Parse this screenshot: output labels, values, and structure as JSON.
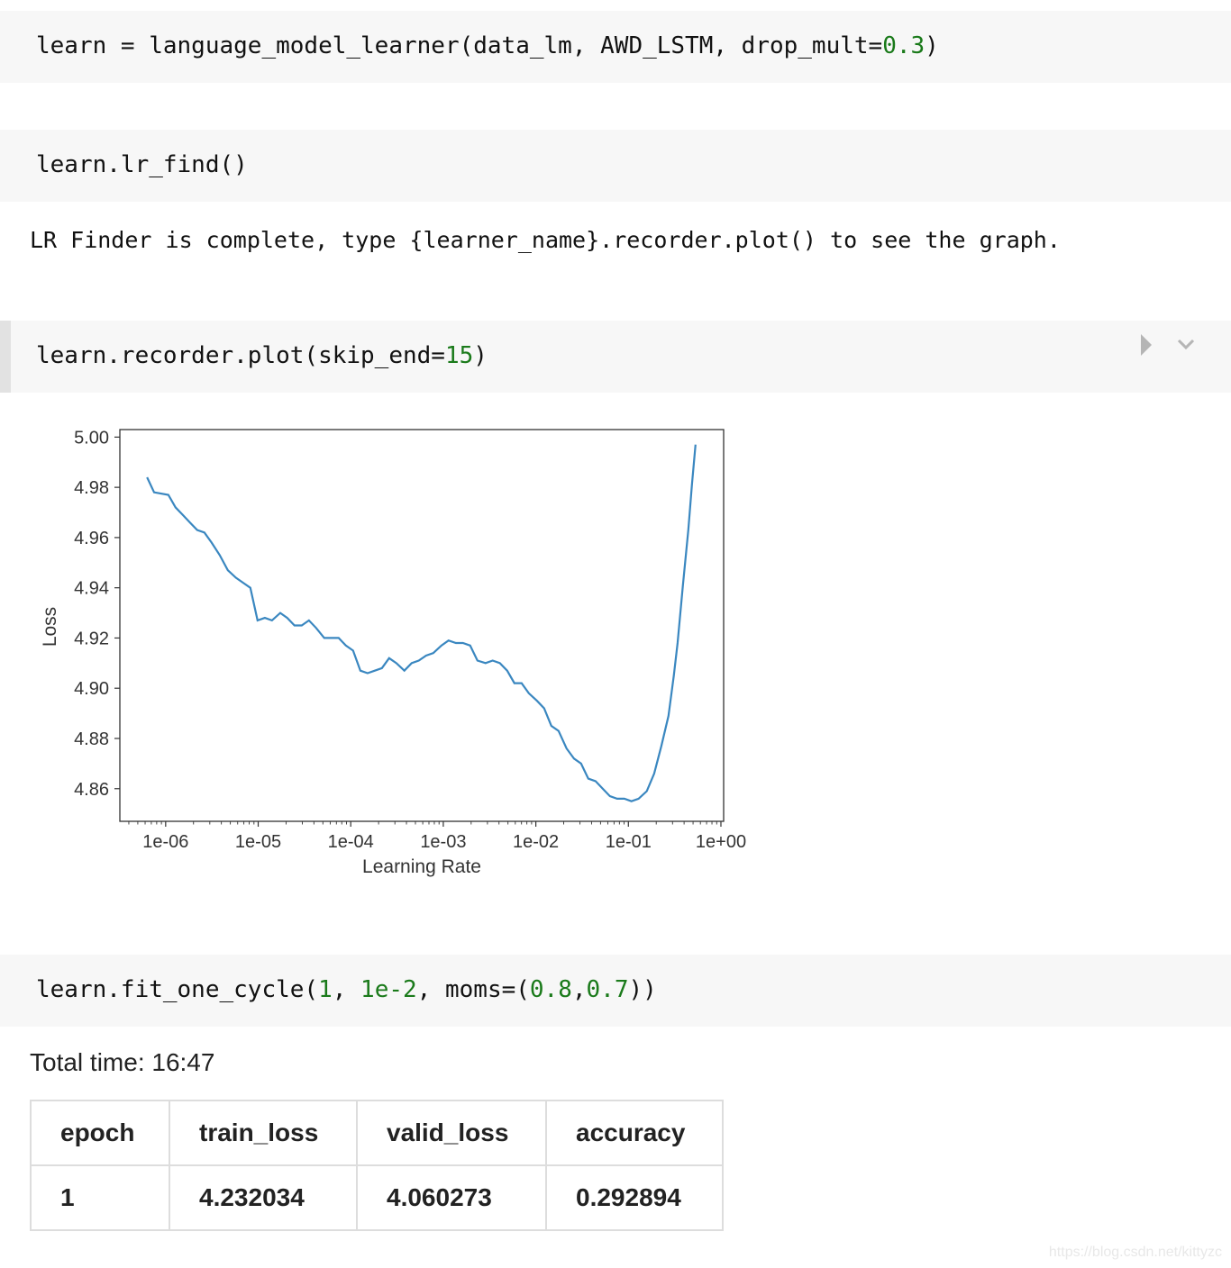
{
  "cells": [
    {
      "code_parts": [
        "learn = language_model_learner(data_lm, AWD_LSTM, drop_mult=",
        "0.3",
        ")"
      ]
    },
    {
      "code_parts": [
        "learn.lr_find()"
      ]
    },
    {
      "code_parts": [
        "learn.recorder.plot(skip_end=",
        "15",
        ")"
      ]
    },
    {
      "code_parts": [
        "learn.fit_one_cycle(",
        "1",
        ", ",
        "1e-2",
        ", moms=(",
        "0.8",
        ",",
        "0.7",
        "))"
      ]
    }
  ],
  "lr_find_output": "LR Finder is complete, type {learner_name}.recorder.plot() to see the graph.",
  "cell_toolbar": {
    "run_icon": "play-triangle-icon",
    "collapse_icon": "chevron-down-icon"
  },
  "total_time": "Total time: 16:47",
  "results_table": {
    "headers": [
      "epoch",
      "train_loss",
      "valid_loss",
      "accuracy"
    ],
    "rows": [
      [
        "1",
        "4.232034",
        "4.060273",
        "0.292894"
      ]
    ]
  },
  "watermark": "https://blog.csdn.net/kittyzc",
  "colors": {
    "line": "#3a87c0",
    "number": "#1a7a1a",
    "cell_bg": "#f7f7f7"
  },
  "chart_data": {
    "type": "line",
    "xlabel": "Learning Rate",
    "ylabel": "Loss",
    "xscale": "log",
    "xlim": [
      3.2e-07,
      1.07
    ],
    "ylim": [
      4.847,
      5.003
    ],
    "xticks": [
      "1e-06",
      "1e-05",
      "1e-04",
      "1e-03",
      "1e-02",
      "1e-01",
      "1e+00"
    ],
    "yticks": [
      "4.86",
      "4.88",
      "4.90",
      "4.92",
      "4.94",
      "4.96",
      "4.98",
      "5.00"
    ],
    "grid": false,
    "x": [
      6.3e-07,
      7.5e-07,
      1.07e-06,
      1.28e-06,
      1.53e-06,
      1.83e-06,
      2.19e-06,
      2.62e-06,
      3.14e-06,
      3.84e-06,
      4.7e-06,
      5.75e-06,
      6.87e-06,
      8.22e-06,
      9.84e-06,
      1.18e-05,
      1.41e-05,
      1.73e-05,
      2.06e-05,
      2.47e-05,
      2.95e-05,
      3.53e-05,
      4.23e-05,
      5.17e-05,
      6.19e-05,
      7.4e-05,
      8.86e-05,
      0.000106,
      0.000127,
      0.000152,
      0.000182,
      0.000217,
      0.00026,
      0.000311,
      0.00038,
      0.000455,
      0.000544,
      0.000652,
      0.00078,
      0.000955,
      0.00114,
      0.00137,
      0.00163,
      0.00195,
      0.00234,
      0.00286,
      0.00342,
      0.00409,
      0.0049,
      0.00586,
      0.00701,
      0.00839,
      0.0103,
      0.0123,
      0.0147,
      0.0176,
      0.0215,
      0.0258,
      0.0308,
      0.0369,
      0.0442,
      0.0528,
      0.0631,
      0.0755,
      0.0904,
      0.108,
      0.129,
      0.158,
      0.19,
      0.227,
      0.271,
      0.31,
      0.34,
      0.388,
      0.444,
      0.486,
      0.532
    ],
    "y": [
      4.984,
      4.978,
      4.977,
      4.972,
      4.969,
      4.966,
      4.963,
      4.962,
      4.958,
      4.953,
      4.947,
      4.944,
      4.942,
      4.94,
      4.927,
      4.928,
      4.927,
      4.93,
      4.928,
      4.925,
      4.925,
      4.927,
      4.924,
      4.92,
      4.92,
      4.92,
      4.917,
      4.915,
      4.907,
      4.906,
      4.907,
      4.908,
      4.912,
      4.91,
      4.907,
      4.91,
      4.911,
      4.913,
      4.914,
      4.917,
      4.919,
      4.918,
      4.918,
      4.917,
      4.911,
      4.91,
      4.911,
      4.91,
      4.907,
      4.902,
      4.902,
      4.898,
      4.895,
      4.892,
      4.885,
      4.883,
      4.876,
      4.872,
      4.87,
      4.864,
      4.863,
      4.86,
      4.857,
      4.856,
      4.856,
      4.855,
      4.856,
      4.859,
      4.866,
      4.877,
      4.889,
      4.905,
      4.918,
      4.941,
      4.963,
      4.981,
      4.997
    ]
  }
}
